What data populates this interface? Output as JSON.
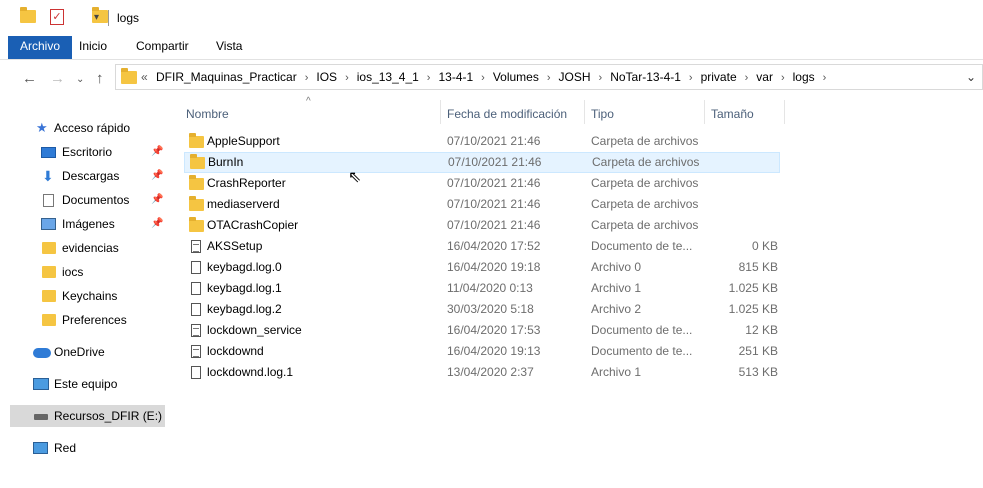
{
  "window": {
    "title": "logs"
  },
  "ribbon": {
    "tabs": [
      "Archivo",
      "Inicio",
      "Compartir",
      "Vista"
    ]
  },
  "address": {
    "overflow": "«",
    "crumbs": [
      "DFIR_Maquinas_Practicar",
      "IOS",
      "ios_13_4_1",
      "13-4-1",
      "Volumes",
      "JOSH",
      "NoTar-13-4-1",
      "private",
      "var",
      "logs"
    ]
  },
  "nav": {
    "items": [
      {
        "label": "Acceso rápido",
        "icon": "star-icon"
      },
      {
        "label": "Escritorio",
        "icon": "desktop-icon",
        "pinned": true
      },
      {
        "label": "Descargas",
        "icon": "download-icon",
        "pinned": true
      },
      {
        "label": "Documentos",
        "icon": "documents-icon",
        "pinned": true
      },
      {
        "label": "Imágenes",
        "icon": "pictures-icon",
        "pinned": true
      },
      {
        "label": "evidencias",
        "icon": "folder-icon"
      },
      {
        "label": "iocs",
        "icon": "folder-icon"
      },
      {
        "label": "Keychains",
        "icon": "folder-icon"
      },
      {
        "label": "Preferences",
        "icon": "folder-icon"
      },
      {
        "label": "OneDrive",
        "icon": "onedrive-icon"
      },
      {
        "label": "Este equipo",
        "icon": "this-pc-icon"
      },
      {
        "label": "Recursos_DFIR (E:)",
        "icon": "drive-icon",
        "selected": true
      },
      {
        "label": "Red",
        "icon": "network-icon"
      }
    ]
  },
  "columns": {
    "name": "Nombre",
    "date": "Fecha de modificación",
    "type": "Tipo",
    "size": "Tamaño"
  },
  "files": [
    {
      "name": "AppleSupport",
      "date": "07/10/2021 21:46",
      "type": "Carpeta de archivos",
      "size": "",
      "kind": "folder"
    },
    {
      "name": "BurnIn",
      "date": "07/10/2021 21:46",
      "type": "Carpeta de archivos",
      "size": "",
      "kind": "folder",
      "hover": true
    },
    {
      "name": "CrashReporter",
      "date": "07/10/2021 21:46",
      "type": "Carpeta de archivos",
      "size": "",
      "kind": "folder"
    },
    {
      "name": "mediaserverd",
      "date": "07/10/2021 21:46",
      "type": "Carpeta de archivos",
      "size": "",
      "kind": "folder"
    },
    {
      "name": "OTACrashCopier",
      "date": "07/10/2021 21:46",
      "type": "Carpeta de archivos",
      "size": "",
      "kind": "folder"
    },
    {
      "name": "AKSSetup",
      "date": "16/04/2020 17:52",
      "type": "Documento de te...",
      "size": "0 KB",
      "kind": "text"
    },
    {
      "name": "keybagd.log.0",
      "date": "16/04/2020 19:18",
      "type": "Archivo 0",
      "size": "815 KB",
      "kind": "file"
    },
    {
      "name": "keybagd.log.1",
      "date": "11/04/2020 0:13",
      "type": "Archivo 1",
      "size": "1.025 KB",
      "kind": "file"
    },
    {
      "name": "keybagd.log.2",
      "date": "30/03/2020 5:18",
      "type": "Archivo 2",
      "size": "1.025 KB",
      "kind": "file"
    },
    {
      "name": "lockdown_service",
      "date": "16/04/2020 17:53",
      "type": "Documento de te...",
      "size": "12 KB",
      "kind": "text"
    },
    {
      "name": "lockdownd",
      "date": "16/04/2020 19:13",
      "type": "Documento de te...",
      "size": "251 KB",
      "kind": "text"
    },
    {
      "name": "lockdownd.log.1",
      "date": "13/04/2020 2:37",
      "type": "Archivo 1",
      "size": "513 KB",
      "kind": "file"
    }
  ],
  "colors": {
    "accent": "#1a5fb4",
    "folder": "#f5c542",
    "hover": "#e5f3ff",
    "selected": "#d9d9d9"
  }
}
